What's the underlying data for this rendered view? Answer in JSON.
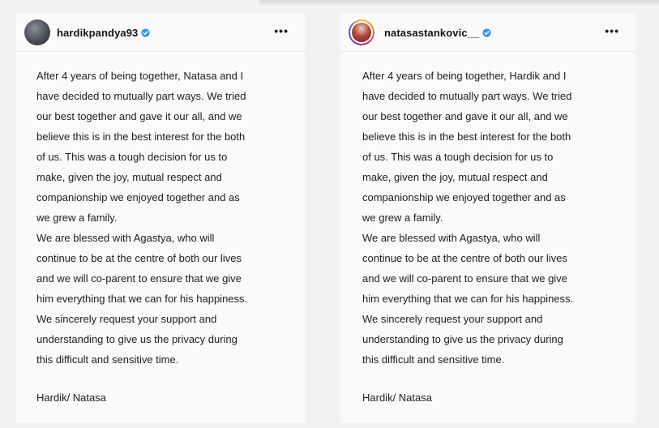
{
  "colors": {
    "verified": "#3897f0",
    "text": "#202020",
    "card_background": "#fafafa",
    "page_background": "#f2f2f2"
  },
  "posts": [
    {
      "username": "hardikpandya93",
      "verified": true,
      "more_icon": "more-horizontal-icon",
      "caption_lines": [
        "After 4 years of being together, Natasa and I",
        "have decided to mutually part ways. We tried",
        "our best together and gave it our all, and we",
        "believe this is in the best interest for the both",
        "of us. This was a tough decision for us to",
        "make, given the joy, mutual respect and",
        "companionship we enjoyed together and as",
        "we grew a family.",
        "We are blessed with Agastya, who will",
        "continue to be at the centre of both our lives",
        "and we will co-parent to ensure that we give",
        "him everything that we can for his happiness.",
        "We sincerely request your support and",
        "understanding to give us the privacy during",
        "this difficult and sensitive time."
      ],
      "signature": "Hardik/ Natasa"
    },
    {
      "username": "natasastankovic__",
      "verified": true,
      "more_icon": "more-horizontal-icon",
      "caption_lines": [
        "After 4 years of being together, Hardik and I",
        "have decided to mutually part ways. We tried",
        "our best together and gave it our all, and we",
        "believe this is in the best interest for the both",
        "of us. This was a tough decision for us to",
        "make, given the joy, mutual respect and",
        "companionship we enjoyed together and as",
        "we grew a family.",
        "We are blessed with Agastya, who will",
        "continue to be at the centre of both our lives",
        "and we will co-parent to ensure that we give",
        "him everything that we can for his happiness.",
        "We sincerely request your support and",
        "understanding to give us the privacy during",
        "this difficult and sensitive time."
      ],
      "signature": "Hardik/ Natasa"
    }
  ]
}
